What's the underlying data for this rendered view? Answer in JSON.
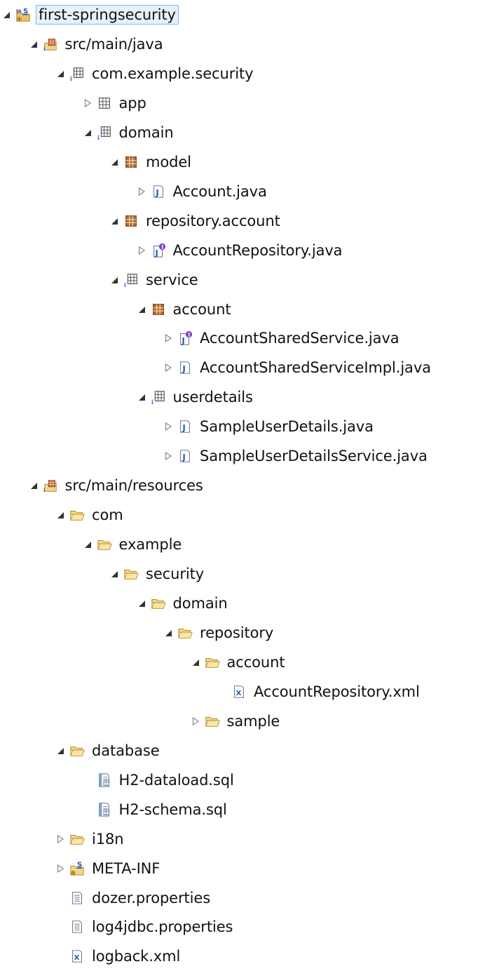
{
  "tree": [
    {
      "label": "first-springsecurity",
      "depth": 0,
      "twisty": "expanded",
      "icon": "maven-spring-project-icon",
      "selected": true
    },
    {
      "label": "src/main/java",
      "depth": 1,
      "twisty": "expanded",
      "icon": "source-folder-icon"
    },
    {
      "label": "com.example.security",
      "depth": 2,
      "twisty": "expanded",
      "icon": "package-info-icon"
    },
    {
      "label": "app",
      "depth": 3,
      "twisty": "collapsed",
      "icon": "package-empty-icon"
    },
    {
      "label": "domain",
      "depth": 3,
      "twisty": "expanded",
      "icon": "package-info-icon"
    },
    {
      "label": "model",
      "depth": 4,
      "twisty": "expanded",
      "icon": "package-icon"
    },
    {
      "label": "Account.java",
      "depth": 5,
      "twisty": "collapsed",
      "icon": "java-file-icon"
    },
    {
      "label": "repository.account",
      "depth": 4,
      "twisty": "expanded",
      "icon": "package-icon"
    },
    {
      "label": "AccountRepository.java",
      "depth": 5,
      "twisty": "collapsed",
      "icon": "java-interface-file-icon"
    },
    {
      "label": "service",
      "depth": 4,
      "twisty": "expanded",
      "icon": "package-info-icon"
    },
    {
      "label": "account",
      "depth": 5,
      "twisty": "expanded",
      "icon": "package-icon"
    },
    {
      "label": "AccountSharedService.java",
      "depth": 6,
      "twisty": "collapsed",
      "icon": "java-interface-file-icon"
    },
    {
      "label": "AccountSharedServiceImpl.java",
      "depth": 6,
      "twisty": "collapsed",
      "icon": "java-file-icon"
    },
    {
      "label": "userdetails",
      "depth": 5,
      "twisty": "expanded",
      "icon": "package-info-icon"
    },
    {
      "label": "SampleUserDetails.java",
      "depth": 6,
      "twisty": "collapsed",
      "icon": "java-file-icon"
    },
    {
      "label": "SampleUserDetailsService.java",
      "depth": 6,
      "twisty": "collapsed",
      "icon": "java-file-icon"
    },
    {
      "label": "src/main/resources",
      "depth": 1,
      "twisty": "expanded",
      "icon": "source-folder-icon"
    },
    {
      "label": "com",
      "depth": 2,
      "twisty": "expanded",
      "icon": "folder-open-icon"
    },
    {
      "label": "example",
      "depth": 3,
      "twisty": "expanded",
      "icon": "folder-open-icon"
    },
    {
      "label": "security",
      "depth": 4,
      "twisty": "expanded",
      "icon": "folder-open-icon"
    },
    {
      "label": "domain",
      "depth": 5,
      "twisty": "expanded",
      "icon": "folder-open-icon"
    },
    {
      "label": "repository",
      "depth": 6,
      "twisty": "expanded",
      "icon": "folder-open-icon"
    },
    {
      "label": "account",
      "depth": 7,
      "twisty": "expanded",
      "icon": "folder-open-icon"
    },
    {
      "label": "AccountRepository.xml",
      "depth": 8,
      "twisty": "none",
      "icon": "xml-file-icon"
    },
    {
      "label": "sample",
      "depth": 7,
      "twisty": "collapsed",
      "icon": "folder-open-icon"
    },
    {
      "label": "database",
      "depth": 2,
      "twisty": "expanded",
      "icon": "folder-open-icon"
    },
    {
      "label": "H2-dataload.sql",
      "depth": 3,
      "twisty": "none",
      "icon": "sql-file-icon"
    },
    {
      "label": "H2-schema.sql",
      "depth": 3,
      "twisty": "none",
      "icon": "sql-file-icon"
    },
    {
      "label": "i18n",
      "depth": 2,
      "twisty": "collapsed",
      "icon": "folder-open-icon"
    },
    {
      "label": "META-INF",
      "depth": 2,
      "twisty": "collapsed",
      "icon": "spring-folder-icon"
    },
    {
      "label": "dozer.properties",
      "depth": 2,
      "twisty": "none",
      "icon": "properties-file-icon"
    },
    {
      "label": "log4jdbc.properties",
      "depth": 2,
      "twisty": "none",
      "icon": "properties-file-icon"
    },
    {
      "label": "logback.xml",
      "depth": 2,
      "twisty": "none",
      "icon": "xml-file-icon"
    }
  ]
}
